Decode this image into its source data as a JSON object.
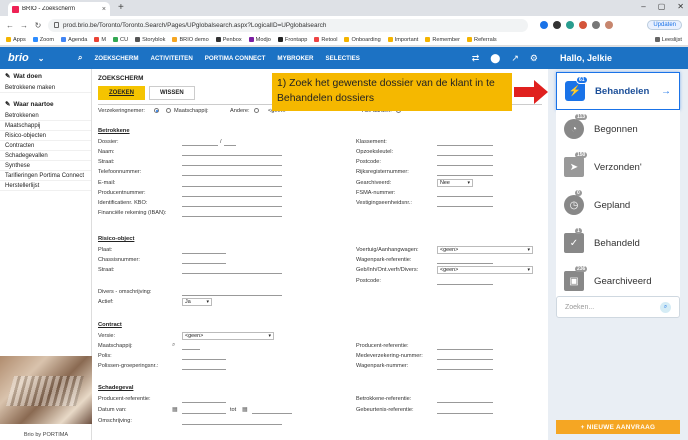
{
  "browser": {
    "tab_title": "BRIO - Zoekscherm",
    "url": "prod.brio.be/Toronto/Toronto.Search/Pages/UPglobalsearch.aspx?LogicalID=UPglobalsearch",
    "update_label": "Updaten",
    "bookmarks": [
      "Apps",
      "Zoom",
      "Agenda",
      "M",
      "CU",
      "Storyblok",
      "BRIO demo",
      "Penbox",
      "Modjo",
      "Frontapp",
      "Retool",
      "Onboarding",
      "Important",
      "Remember",
      "Referrals",
      "Leeslijst"
    ]
  },
  "topnav": {
    "logo": "brio",
    "menu": [
      "ZOEKSCHERM",
      "ACTIVITEITEN",
      "PORTIMA CONNECT",
      "MYBROKER",
      "SELECTIES"
    ]
  },
  "greeting": "Hallo, Jelkie",
  "sidebar": {
    "section1": "Wat doen",
    "section1_items": [
      "Betrokkene maken"
    ],
    "section2": "Waar naartoe",
    "section2_items": [
      "Betrokkenen",
      "Maatschappij",
      "Risico-objecten",
      "Contracten",
      "Schadegevallen",
      "Synthese",
      "Tarifieringen Portima Connect",
      "Herstellerlijst"
    ],
    "footer": "Brio by PORTIMA"
  },
  "form": {
    "title": "ZOEKSCHERM",
    "tabs": [
      "ZOEKEN",
      "WISSEN"
    ],
    "verzekeringnemer": "Verzekeringnemer:",
    "maatschappij_r": "Maatschappij:",
    "andere": "Andere:",
    "geen": "<geen>",
    "alle_aarden": "Alle aarden:",
    "betrokkene_title": "Betrokkene",
    "betrokkene_left": [
      "Dossier:",
      "Naam:",
      "Straat:",
      "Telefoonnummer:",
      "E-mail:",
      "Producentnummer:",
      "Identificatienr. KBO:",
      "Financiële rekening (IBAN):"
    ],
    "betrokkene_right": [
      "Klassement:",
      "Opzoeksleutel:",
      "Postcode:",
      "Rijksregisternummer:",
      "Gearchiveerd:",
      "FSMA-nummer:",
      "Vestigingseenheidsnr.:"
    ],
    "gearchiveerd_value": "Nee",
    "risico_title": "Risico-object",
    "risico_left": [
      "Plaat:",
      "Chassisnummer:",
      "Straat:",
      "",
      "Divers - omschrijving:",
      "Actief:"
    ],
    "risico_right": [
      "Voertuig/Aanhangwagen:",
      "Wagenpark-referentie:",
      "Geb/Inh/Ont.verfr/Divers:",
      "Postcode:"
    ],
    "actief_value": "Ja",
    "contract_title": "Contract",
    "contract_left": [
      "Versie:",
      "Maatschappij:",
      "Polis:",
      "Polissen-groeperingsnr.:"
    ],
    "contract_right": [
      "Producent-referentie:",
      "Medeverzekering-nummer:",
      "Wagenpark-nummer:"
    ],
    "schade_title": "Schadegeval",
    "schade_left": [
      "Producent-referentie:",
      "Datum van:",
      "Omschrijving:"
    ],
    "schade_right": [
      "Betrokkene-referentie:",
      "Gebeurtenis-referentie:"
    ],
    "tot": "tot"
  },
  "annotation": "1) Zoek het gewenste dossier van de klant in te Behandelen dossiers",
  "panel": {
    "items": [
      {
        "label": "Behandelen",
        "count": "61"
      },
      {
        "label": "Begonnen",
        "count": "113"
      },
      {
        "label": "Verzonden'",
        "count": "150"
      },
      {
        "label": "Gepland",
        "count": "0"
      },
      {
        "label": "Behandeld",
        "count": "1"
      },
      {
        "label": "Gearchiveerd",
        "count": "236"
      }
    ],
    "search_placeholder": "Zoeken...",
    "new_request": "+ NIEUWE AANVRAAG"
  },
  "colors": {
    "brand_blue": "#1c72c4",
    "accent_yellow": "#f5c400",
    "annotation": "#f5b800",
    "arrow": "#e0201e",
    "new_button": "#f5a623"
  }
}
